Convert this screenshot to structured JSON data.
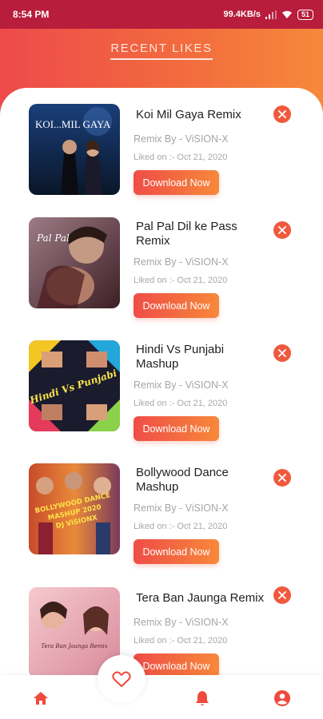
{
  "status": {
    "time": "8:54 PM",
    "network": "99.4KB/s",
    "battery": "51"
  },
  "page_title": "RECENT LIKES",
  "colors": {
    "accent_start": "#ef4d47",
    "accent_end": "#f7883a",
    "remove": "#ef5a3e"
  },
  "items": [
    {
      "title_line1": "Koi Mil Gaya Remix",
      "title_line2": "",
      "artist": "Remix By - ViSION-X",
      "liked": "Liked on :- Oct 21, 2020",
      "download": "Download Now",
      "cover_text": "KOI...MIL GAYA"
    },
    {
      "title_line1": "Pal Pal Dil ke Pass",
      "title_line2": "Remix",
      "artist": "Remix By - ViSION-X",
      "liked": "Liked on :- Oct 21, 2020",
      "download": "Download Now",
      "cover_text": "Pal Pal"
    },
    {
      "title_line1": "Hindi Vs Punjabi",
      "title_line2": "Mashup",
      "artist": "Remix By - ViSION-X",
      "liked": "Liked on :- Oct 21, 2020",
      "download": "Download Now",
      "cover_text": "Hindi Vs Punjabi"
    },
    {
      "title_line1": "Bollywood Dance",
      "title_line2": "Mashup",
      "artist": "Remix By - ViSION-X",
      "liked": "Liked on :- Oct 21, 2020",
      "download": "Download Now",
      "cover_text_1": "BOLLYWOOD DANCE",
      "cover_text_2": "MASHUP 2020",
      "cover_text_3": "DJ ViSIONX"
    },
    {
      "title_line1": "Tera Ban Jaunga Remix",
      "title_line2": "",
      "artist": "Remix By - ViSION-X",
      "liked": "Liked on :- Oct 21, 2020",
      "download": "Download Now",
      "cover_text": "Tera Ban Jaunga Remix"
    }
  ],
  "nav": {
    "icons": [
      "home-icon",
      "heart-icon",
      "bell-icon",
      "profile-icon"
    ]
  }
}
